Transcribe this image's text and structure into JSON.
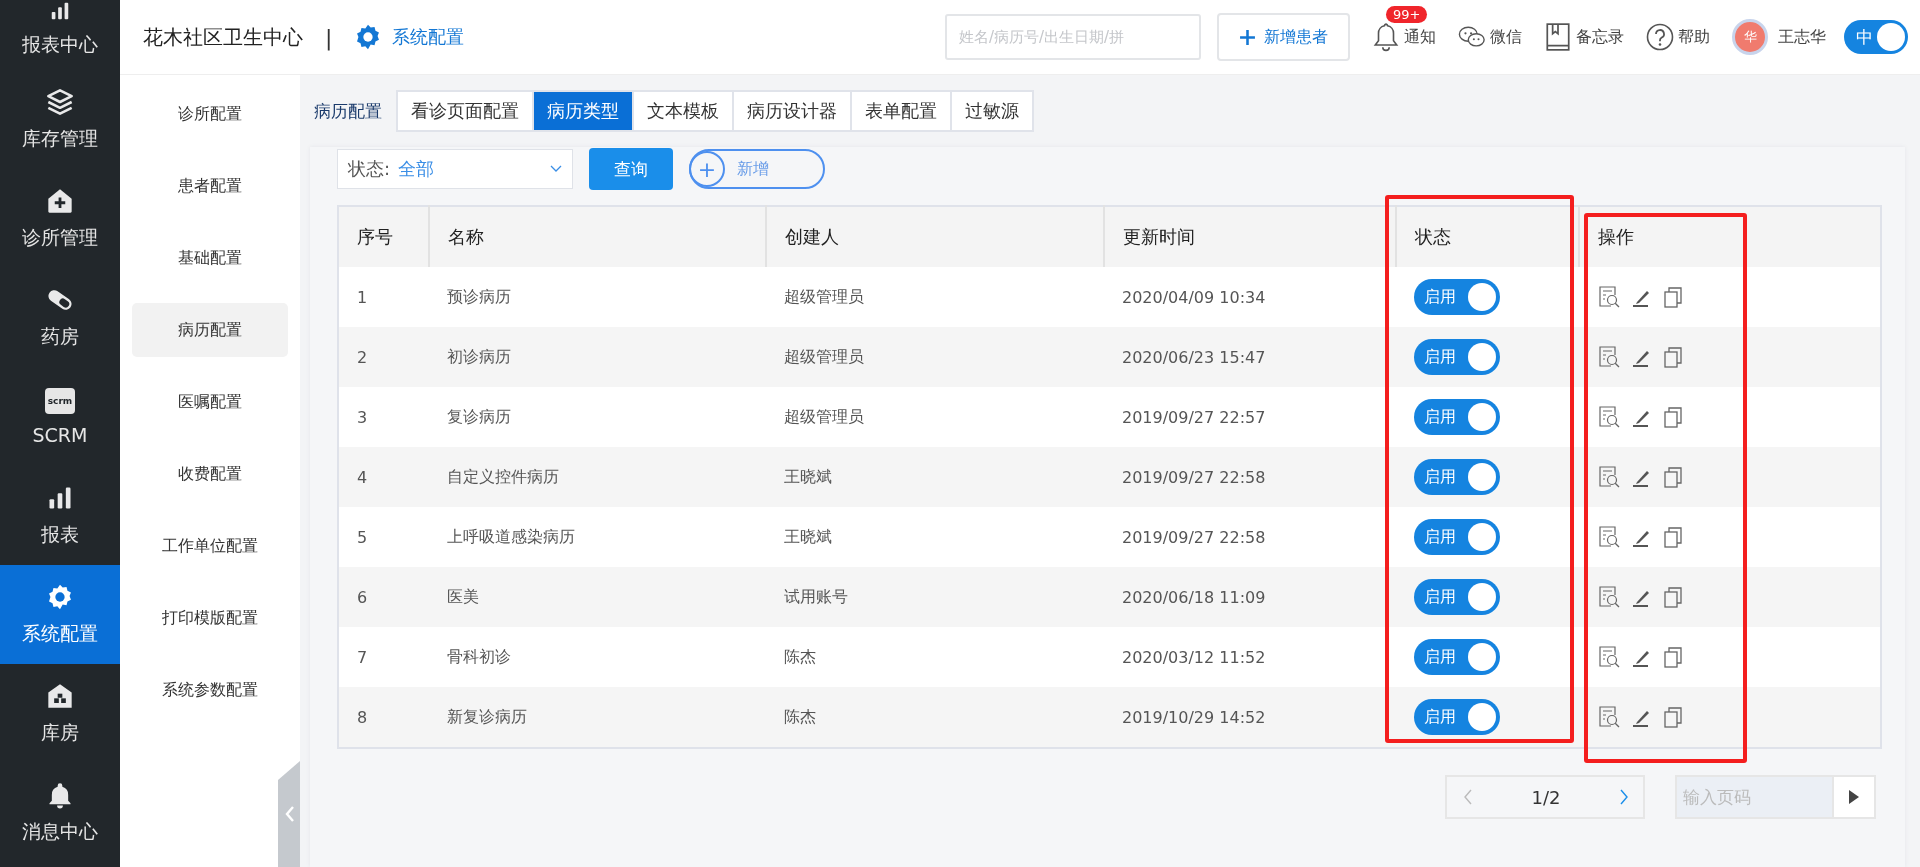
{
  "nav": [
    {
      "label": "报表中心",
      "kind": "bars",
      "selected": false
    },
    {
      "label": "库存管理",
      "kind": "layers",
      "selected": false
    },
    {
      "label": "诊所管理",
      "kind": "clinic",
      "selected": false
    },
    {
      "label": "药房",
      "kind": "pill",
      "selected": false
    },
    {
      "label": "SCRM",
      "kind": "scrm",
      "icon_text": "scrm",
      "selected": false
    },
    {
      "label": "报表",
      "kind": "bars",
      "selected": false
    },
    {
      "label": "系统配置",
      "kind": "gear",
      "selected": true
    },
    {
      "label": "库房",
      "kind": "warehouse",
      "selected": false
    },
    {
      "label": "消息中心",
      "kind": "bell",
      "selected": false
    }
  ],
  "header": {
    "org": "花木社区卫生中心",
    "separator": "|",
    "module": "系统配置",
    "search": {
      "placeholder": "姓名/病历号/出生日期/拼"
    },
    "add_button": "新增患者",
    "actions": [
      {
        "label": "通知",
        "kind": "bell",
        "badge": "99+"
      },
      {
        "label": "微信",
        "kind": "chat"
      },
      {
        "label": "备忘录",
        "kind": "book"
      },
      {
        "label": "帮助",
        "kind": "help"
      }
    ],
    "user": {
      "avatar": "华",
      "name": "王志华"
    },
    "lang_toggle": {
      "label": "中",
      "on": true
    }
  },
  "subnav": [
    {
      "label": "诊所配置",
      "selected": false
    },
    {
      "label": "患者配置",
      "selected": false
    },
    {
      "label": "基础配置",
      "selected": false
    },
    {
      "label": "病历配置",
      "selected": true
    },
    {
      "label": "医嘱配置",
      "selected": false
    },
    {
      "label": "收费配置",
      "selected": false
    },
    {
      "label": "工作单位配置",
      "selected": false
    },
    {
      "label": "打印模版配置",
      "selected": false
    },
    {
      "label": "系统参数配置",
      "selected": false
    }
  ],
  "section_title": "病历配置",
  "tabs": [
    {
      "label": "看诊页面配置",
      "selected": false
    },
    {
      "label": "病历类型",
      "selected": true
    },
    {
      "label": "文本模板",
      "selected": false
    },
    {
      "label": "病历设计器",
      "selected": false
    },
    {
      "label": "表单配置",
      "selected": false
    },
    {
      "label": "过敏源",
      "selected": false
    }
  ],
  "filter": {
    "label": "状态:",
    "value": "全部"
  },
  "query_button": "查询",
  "add_button": {
    "icon": "+",
    "label": "新增"
  },
  "table": {
    "columns": [
      {
        "label": "序号",
        "highlighted": false
      },
      {
        "label": "名称",
        "highlighted": false
      },
      {
        "label": "创建人",
        "highlighted": false
      },
      {
        "label": "更新时间",
        "highlighted": false
      },
      {
        "label": "状态",
        "highlighted": true
      },
      {
        "label": "操作",
        "highlighted": true
      }
    ],
    "rows": [
      {
        "no": "1",
        "name": "预诊病历",
        "creator": "超级管理员",
        "updated": "2020/04/09 10:34",
        "status": {
          "label": "启用",
          "on": true
        }
      },
      {
        "no": "2",
        "name": "初诊病历",
        "creator": "超级管理员",
        "updated": "2020/06/23 15:47",
        "status": {
          "label": "启用",
          "on": true
        }
      },
      {
        "no": "3",
        "name": "复诊病历",
        "creator": "超级管理员",
        "updated": "2019/09/27 22:57",
        "status": {
          "label": "启用",
          "on": true
        }
      },
      {
        "no": "4",
        "name": "自定义控件病历",
        "creator": "王晓斌",
        "updated": "2019/09/27 22:58",
        "status": {
          "label": "启用",
          "on": true
        }
      },
      {
        "no": "5",
        "name": "上呼吸道感染病历",
        "creator": "王晓斌",
        "updated": "2019/09/27 22:58",
        "status": {
          "label": "启用",
          "on": true
        }
      },
      {
        "no": "6",
        "name": "医美",
        "creator": "试用账号",
        "updated": "2020/06/18 11:09",
        "status": {
          "label": "启用",
          "on": true
        }
      },
      {
        "no": "7",
        "name": "骨科初诊",
        "creator": "陈杰",
        "updated": "2020/03/12 11:52",
        "status": {
          "label": "启用",
          "on": true
        }
      },
      {
        "no": "8",
        "name": "新复诊病历",
        "creator": "陈杰",
        "updated": "2019/10/29 14:52",
        "status": {
          "label": "启用",
          "on": true
        }
      }
    ]
  },
  "pagination": {
    "page": "1/2",
    "prev_disabled": true,
    "next_disabled": false,
    "jump": {
      "placeholder": "输入页码"
    }
  }
}
